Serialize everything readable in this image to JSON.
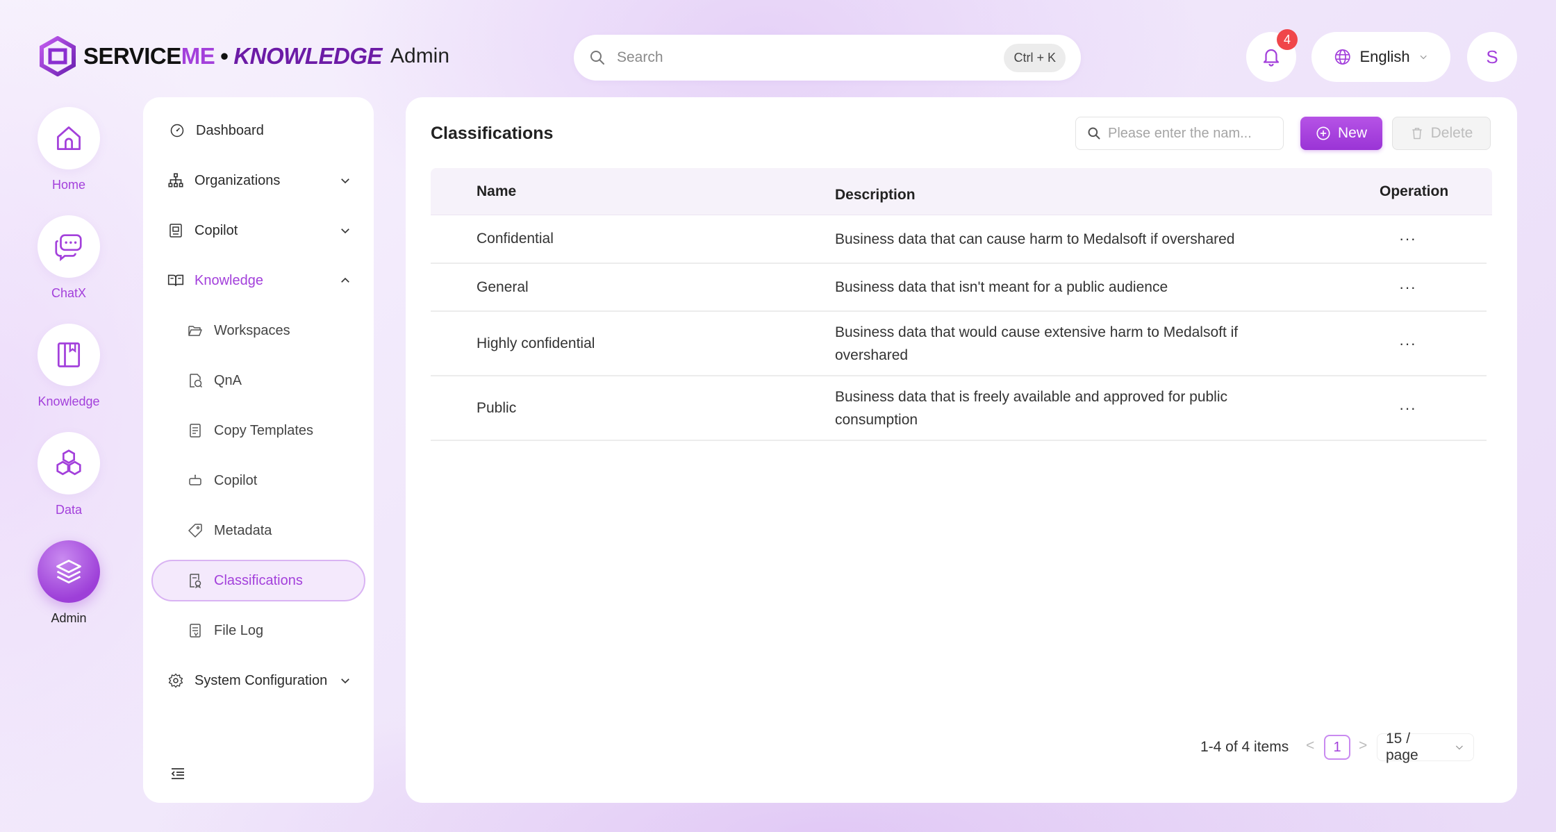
{
  "header": {
    "brand_service": "SERVICE",
    "brand_me": "ME",
    "brand_dot": "•",
    "brand_knowledge": "KNOWLEDGE",
    "app_title": "Admin",
    "search_placeholder": "Search",
    "search_shortcut": "Ctrl + K",
    "notification_count": "4",
    "language": "English",
    "avatar_initial": "S"
  },
  "rail": {
    "items": [
      {
        "label": "Home",
        "icon": "home-icon"
      },
      {
        "label": "ChatX",
        "icon": "chat-icon"
      },
      {
        "label": "Knowledge",
        "icon": "book-icon"
      },
      {
        "label": "Data",
        "icon": "hexagons-icon"
      },
      {
        "label": "Admin",
        "icon": "layers-icon",
        "active": true
      }
    ]
  },
  "sidebar": {
    "dashboard": "Dashboard",
    "organizations": "Organizations",
    "copilot": "Copilot",
    "knowledge": "Knowledge",
    "workspaces": "Workspaces",
    "qna": "QnA",
    "copy_templates": "Copy Templates",
    "copilot_sub": "Copilot",
    "metadata": "Metadata",
    "classifications": "Classifications",
    "file_log": "File Log",
    "system_configuration": "System Configuration"
  },
  "main": {
    "title": "Classifications",
    "filter_placeholder": "Please enter the nam...",
    "new_label": "New",
    "delete_label": "Delete",
    "columns": {
      "name": "Name",
      "description": "Description",
      "operation": "Operation"
    },
    "rows": [
      {
        "name": "Confidential",
        "description": "Business data that can cause harm to Medalsoft if overshared",
        "op": "···"
      },
      {
        "name": "General",
        "description": "Business data that isn't meant for a public audience",
        "op": "···"
      },
      {
        "name": "Highly confidential",
        "description": "Business data that would cause extensive harm to Medalsoft if overshared",
        "op": "···"
      },
      {
        "name": "Public",
        "description": "Business data that is freely available and approved for public consumption",
        "op": "···"
      }
    ],
    "pagination": {
      "total": "1-4 of 4 items",
      "prev": "<",
      "current": "1",
      "next": ">",
      "page_size": "15 / page"
    }
  },
  "colors": {
    "accent": "#a340db",
    "badge": "#f0464a"
  }
}
